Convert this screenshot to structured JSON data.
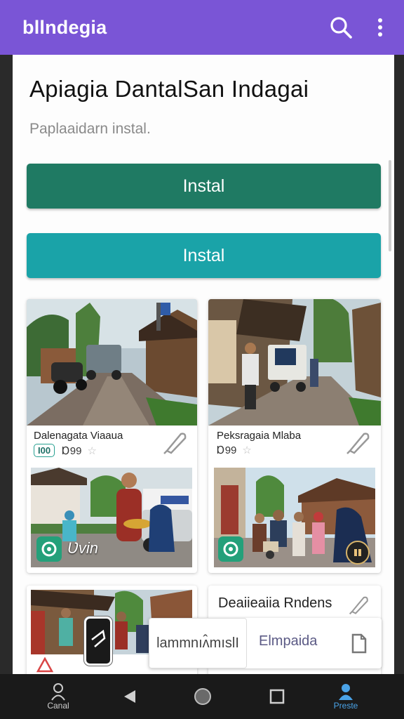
{
  "appbar": {
    "brand": "bllndegia",
    "color": "#7a55d6",
    "search_icon": "search-icon",
    "menu_icon": "more-vert-icon"
  },
  "header": {
    "title": "Apiagia DantalSan Indagai",
    "subtitle": "Paplaaidarn instal."
  },
  "buttons": {
    "primary_label": "Instal",
    "secondary_label": "Instal",
    "primary_color": "#1f7a63",
    "secondary_color": "#1aa3a8"
  },
  "cards": [
    {
      "caption": "Dalenagata Viaaua",
      "tag": "I00",
      "count": "Ɒ99"
    },
    {
      "caption": "Peksragaia Mlaba",
      "tag": "",
      "count": "Ɒ99"
    },
    {
      "overlay": "Ʋvin"
    },
    {
      "overlay": ""
    },
    {
      "heading": "Deaiieaiia Rndens"
    }
  ],
  "bottom_actions": {
    "pill_label": "lammnıʌ̂mıslI",
    "context_label": "Elmpaida",
    "doc_icon": "document-icon"
  },
  "navbar": {
    "left_label": "Canal",
    "right_label": "Preste",
    "active_color": "#4aa3e8"
  }
}
